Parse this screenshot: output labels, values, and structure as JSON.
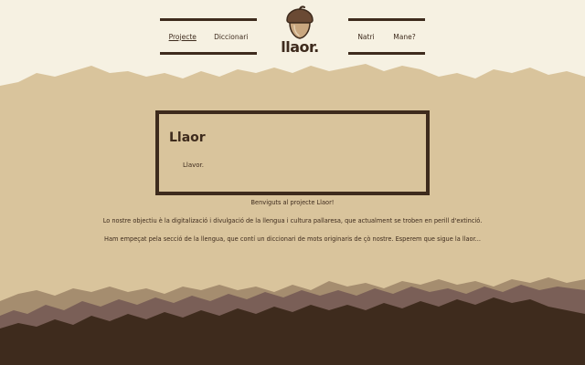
{
  "nav": {
    "left": [
      {
        "label": "Projecte",
        "active": true
      },
      {
        "label": "Diccionari",
        "active": false
      }
    ],
    "right": [
      {
        "label": "Natri",
        "active": false
      },
      {
        "label": "Mane?",
        "active": false
      }
    ]
  },
  "logo": {
    "text": "llaor."
  },
  "card": {
    "title": "Llaor",
    "subtitle": "Llavor."
  },
  "intro": {
    "welcome": "Benviguts al projecte Llaor!",
    "goal": "Lo nostre objectiu è la digitalizació i divulgació de la llengua i cultura pallaresa, que actualment se troben en perill d'extinció.",
    "progress": "Ham empeçat pela secció de la llengua, que contí un diccionari de mots originaris de çò nostre. Esperem que sigue la llaor..."
  },
  "colors": {
    "cream": "#f6f1e2",
    "sand": "#d9c49c",
    "taupe": "#7a5f57",
    "dark_brown": "#3e2b1d"
  }
}
